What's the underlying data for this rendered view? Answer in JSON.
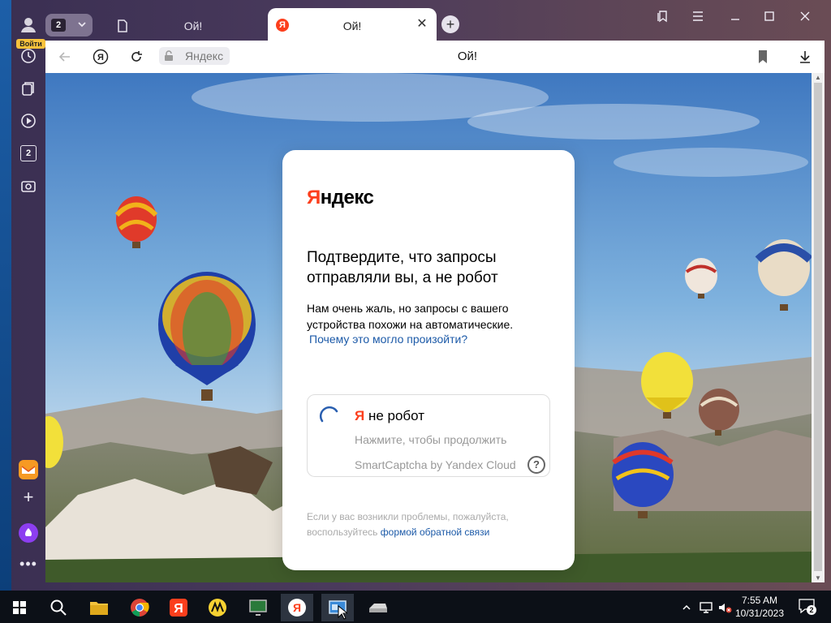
{
  "sidebar": {
    "login_label": "Войти",
    "tabs_count": "2"
  },
  "tabs": {
    "count": "2",
    "tab1_title": "Ой!",
    "tab2_title": "Ой!",
    "tab2_favicon": "Я"
  },
  "addressbar": {
    "domain": "Яндекс",
    "page_title": "Ой!"
  },
  "card": {
    "logo_first": "Я",
    "logo_rest": "ндекс",
    "heading": "Подтвердите, что запросы отправляли вы, а не робот",
    "description": "Нам очень жаль, но запросы с вашего устройства похожи на автоматические.",
    "why_link": "Почему это могло произойти?",
    "captcha": {
      "label_ya": "Я",
      "label_rest": " не робот",
      "hint": "Нажмите, чтобы продолжить",
      "brand": "SmartCaptcha by Yandex Cloud",
      "help": "?"
    },
    "footnote_text": "Если у вас возникли проблемы, пожалуйста, воспользуйтесь ",
    "feedback_link": "формой обратной связи"
  },
  "taskbar": {
    "time": "7:55 AM",
    "date": "10/31/2023",
    "notifications": "2"
  },
  "colors": {
    "yandex_red": "#fc3f1d",
    "link_blue": "#1c5aa8",
    "browser_chrome": "#4a3a5c"
  }
}
